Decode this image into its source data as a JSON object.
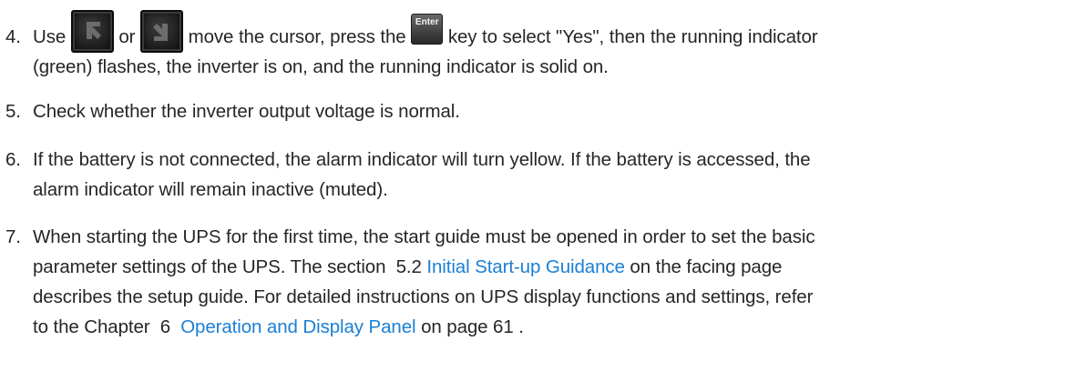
{
  "steps": [
    {
      "number": "4.",
      "seg1": "Use",
      "seg2": "or",
      "seg3": "move the cursor, press the",
      "seg4": "key to select \"Yes\", then the running indicator",
      "line2": "(green) flashes, the inverter is on, and the running indicator is solid on.",
      "key_up_icon": "up-arrow-key-icon",
      "key_down_icon": "down-arrow-key-icon",
      "key_enter_label": "Enter"
    },
    {
      "number": "5.",
      "line1": "Check whether the inverter output voltage is normal."
    },
    {
      "number": "6.",
      "line1": "If the battery is not connected, the alarm indicator will turn yellow. If the battery is accessed, the",
      "line2": "alarm indicator will remain inactive (muted)."
    },
    {
      "number": "7.",
      "line1": "When starting the UPS for the first time, the start guide must be opened in order to set the basic",
      "line2_pre": "parameter settings of the UPS. The section  5.2 ",
      "line2_link": "Initial Start-up Guidance",
      "line2_post": " on the facing page",
      "line3": "describes the setup guide. For detailed instructions on UPS display functions and settings, refer",
      "line4_pre": "to the Chapter  6  ",
      "line4_link": "Operation and Display Panel",
      "line4_post": " on page 61 ."
    }
  ],
  "colors": {
    "text": "#262626",
    "link": "#1a7fd4",
    "key_dark": "#222222",
    "key_arrow": "#6c6c6c"
  }
}
